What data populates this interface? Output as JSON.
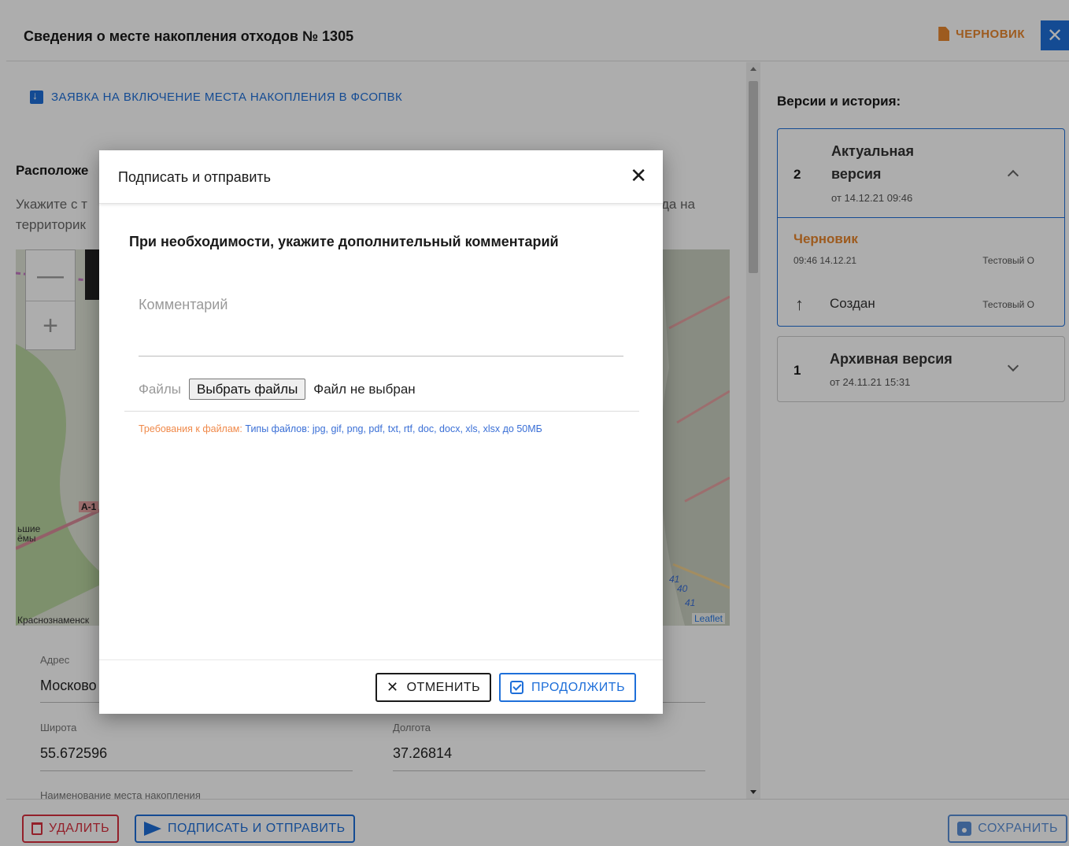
{
  "header": {
    "title": "Сведения о месте накопления отходов № 1305",
    "status_label": "ЧЕРНОВИК"
  },
  "main": {
    "request_link": "ЗАЯВКА НА ВКЛЮЧЕНИЕ МЕСТА НАКОПЛЕНИЯ В ФСОПВК",
    "location_title": "Расположе",
    "location_hint": "Укажите с т                                                                                                                                                       да на территорик",
    "hint_line1": "Укажите с т",
    "hint_line1_tail": "да на",
    "hint_line2": "территорик",
    "map": {
      "labels": [
        "ьшие",
        "ёмы",
        "Краснознаменск",
        "A-1",
        "41",
        "40",
        "41"
      ],
      "attribution": "Leaflet",
      "zoom_in": "+",
      "zoom_out": "—"
    },
    "fields": {
      "address_label": "Адрес",
      "address_value": "Москово",
      "lat_label": "Широта",
      "lat_value": "55.672596",
      "lon_label": "Долгота",
      "lon_value": "37.26814",
      "name_label": "Наименование места накопления"
    }
  },
  "versions": {
    "title": "Версии и история:",
    "active": {
      "number": "2",
      "name_line1": "Актуальная",
      "name_line2": "версия",
      "date": "от 14.12.21 09:46",
      "history": [
        {
          "status": "Черновик",
          "time": "09:46 14.12.21",
          "user": "Тестовый О"
        },
        {
          "action": "Создан",
          "user": "Тестовый О"
        }
      ]
    },
    "archive": {
      "number": "1",
      "name": "Архивная версия",
      "date": "от 24.11.21 15:31"
    }
  },
  "footer": {
    "delete_label": "УДАЛИТЬ",
    "sign_label": "ПОДПИСАТЬ И ОТПРАВИТЬ",
    "save_label": "СОХРАНИТЬ"
  },
  "modal": {
    "title": "Подписать и отправить",
    "subtitle": "При необходимости, укажите дополнительный комментарий",
    "comment_placeholder": "Комментарий",
    "files_label": "Файлы",
    "files_button": "Выбрать файлы",
    "files_none": "Файл не выбран",
    "req_label": "Требования к файлам:",
    "req_text": "Типы файлов: jpg, gif, png, pdf, txt, rtf, doc, docx, xls, xlsx до 50МБ",
    "cancel_label": "ОТМЕНИТЬ",
    "continue_label": "ПРОДОЛЖИТЬ"
  },
  "colors": {
    "accent": "#1e6fd9",
    "draft": "#e8872e",
    "danger": "#d9303e"
  }
}
